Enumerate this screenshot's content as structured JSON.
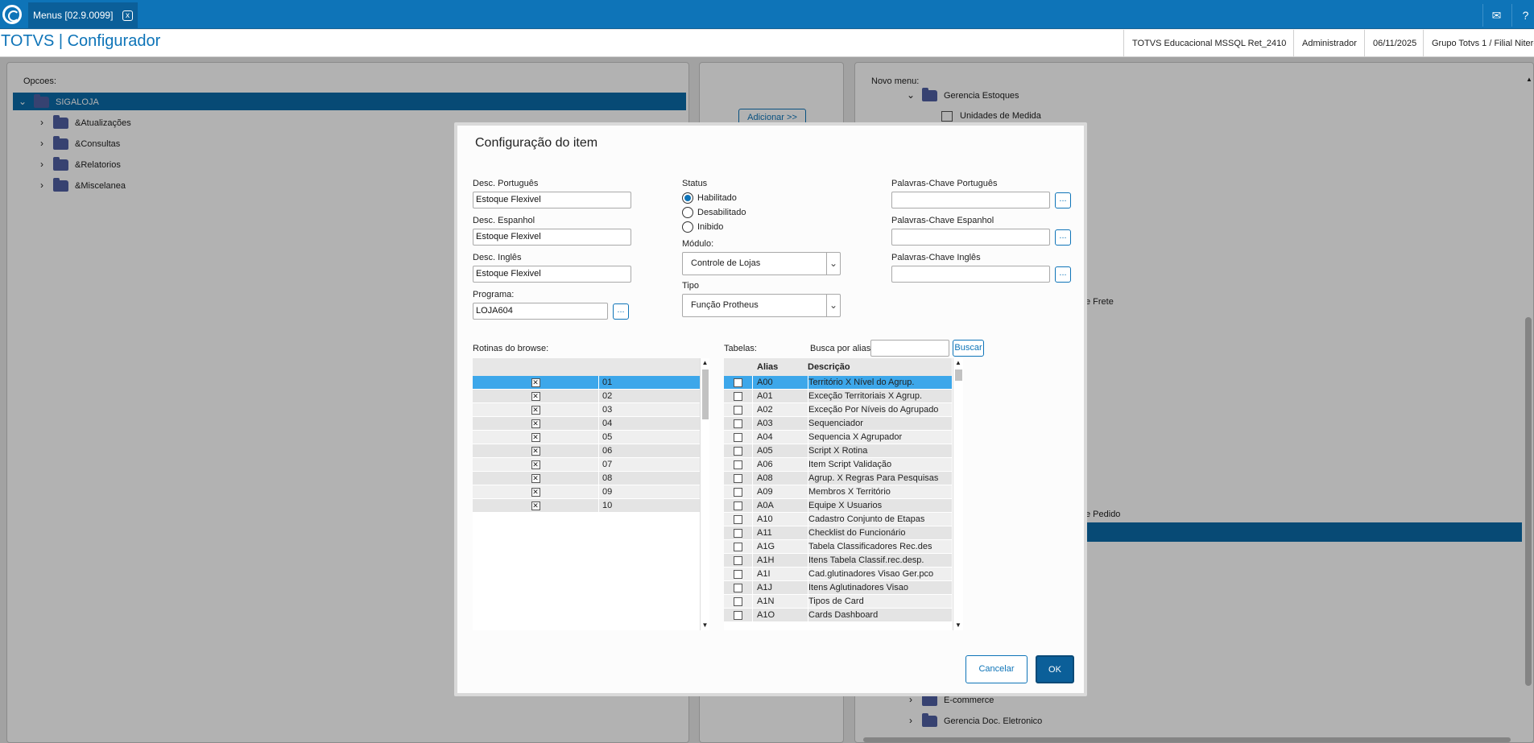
{
  "topbar": {
    "tab_label": "Menus [02.9.0099]",
    "close_glyph": "x",
    "mail_icon": "mail-icon",
    "help_icon": "help-icon"
  },
  "header": {
    "title": "TOTVS | Configurador",
    "environment": "TOTVS Educacional MSSQL Ret_2410",
    "user": "Administrador",
    "date": "06/11/2025",
    "branch": "Grupo Totvs 1 / Filial Niteroi"
  },
  "left_panel": {
    "label": "Opcoes:",
    "items": [
      {
        "label": "SIGALOJA"
      },
      {
        "label": "&Atualizações"
      },
      {
        "label": "&Consultas"
      },
      {
        "label": "&Relatorios"
      },
      {
        "label": "&Miscelanea"
      }
    ]
  },
  "middle_panel": {
    "add_button": "Adicionar >>"
  },
  "right_panel": {
    "label": "Novo menu:",
    "items": [
      {
        "label": "Gerencia Estoques"
      },
      {
        "label": "Unidades de Medida"
      },
      {
        "label": "e Frete"
      },
      {
        "label": "e Pedido"
      },
      {
        "label": "E-commerce"
      },
      {
        "label": "Gerencia Doc. Eletronico"
      }
    ]
  },
  "dialog": {
    "title": "Configuração do item",
    "desc_pt_label": "Desc. Português",
    "desc_pt_value": "Estoque Flexivel",
    "desc_es_label": "Desc. Espanhol",
    "desc_es_value": "Estoque Flexivel",
    "desc_en_label": "Desc. Inglês",
    "desc_en_value": "Estoque Flexivel",
    "program_label": "Programa:",
    "program_value": "LOJA604",
    "status_label": "Status",
    "status_options": [
      "Habilitado",
      "Desabilitado",
      "Inibido"
    ],
    "status_selected": "Habilitado",
    "module_label": "Módulo:",
    "module_value": "Controle de Lojas",
    "type_label": "Tipo",
    "type_value": "Função Protheus",
    "kw_pt_label": "Palavras-Chave Português",
    "kw_es_label": "Palavras-Chave Espanhol",
    "kw_en_label": "Palavras-Chave Inglês",
    "lookup_glyph": "...",
    "routines_label": "Rotinas do browse:",
    "routines": [
      "01",
      "02",
      "03",
      "04",
      "05",
      "06",
      "07",
      "08",
      "09",
      "10"
    ],
    "routines_checked": true,
    "check_glyph": "✕",
    "tables_label": "Tabelas:",
    "search_label": "Busca por alias:",
    "search_value": "",
    "search_button": "Buscar",
    "tables_headers": {
      "alias": "Alias",
      "description": "Descrição"
    },
    "tables": [
      {
        "alias": "A00",
        "desc": "Território X Nível do Agrup."
      },
      {
        "alias": "A01",
        "desc": "Exceção Territoriais X Agrup."
      },
      {
        "alias": "A02",
        "desc": "Exceção Por Níveis do Agrupado"
      },
      {
        "alias": "A03",
        "desc": "Sequenciador"
      },
      {
        "alias": "A04",
        "desc": "Sequencia X Agrupador"
      },
      {
        "alias": "A05",
        "desc": "Script X Rotina"
      },
      {
        "alias": "A06",
        "desc": "Item Script Validação"
      },
      {
        "alias": "A08",
        "desc": "Agrup. X Regras Para Pesquisas"
      },
      {
        "alias": "A09",
        "desc": "Membros X Território"
      },
      {
        "alias": "A0A",
        "desc": "Equipe X Usuarios"
      },
      {
        "alias": "A10",
        "desc": "Cadastro Conjunto de Etapas"
      },
      {
        "alias": "A11",
        "desc": "Checklist do Funcionário"
      },
      {
        "alias": "A1G",
        "desc": "Tabela Classificadores Rec.des"
      },
      {
        "alias": "A1H",
        "desc": "Itens Tabela Classif.rec.desp."
      },
      {
        "alias": "A1I",
        "desc": "Cad.glutinadores Visao Ger.pco"
      },
      {
        "alias": "A1J",
        "desc": "Itens Aglutinadores Visao"
      },
      {
        "alias": "A1N",
        "desc": "Tipos de Card"
      },
      {
        "alias": "A1O",
        "desc": "Cards Dashboard"
      }
    ],
    "cancel_button": "Cancelar",
    "ok_button": "OK"
  },
  "colors": {
    "brand": "#0e74b8",
    "selection": "#3da7ea",
    "tree_selection": "#0b6aa8"
  }
}
